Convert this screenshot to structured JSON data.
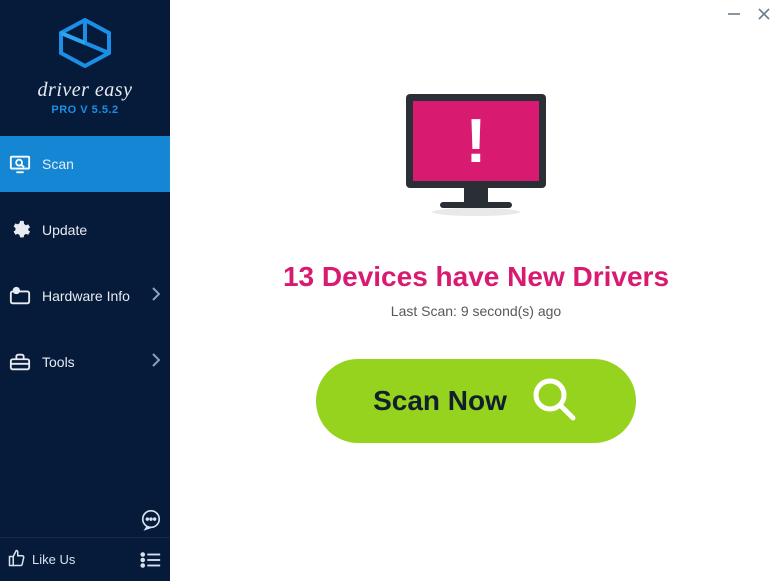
{
  "brand": {
    "title": "driver easy",
    "version": "PRO V 5.5.2"
  },
  "sidebar": {
    "items": [
      {
        "label": "Scan",
        "has_chevron": false,
        "active": true
      },
      {
        "label": "Update",
        "has_chevron": false,
        "active": false
      },
      {
        "label": "Hardware Info",
        "has_chevron": true,
        "active": false
      },
      {
        "label": "Tools",
        "has_chevron": true,
        "active": false
      }
    ],
    "like_label": "Like Us"
  },
  "main": {
    "headline": "13 Devices have New Drivers",
    "last_scan": "Last Scan: 9 second(s) ago",
    "scan_button": "Scan Now"
  },
  "colors": {
    "accent_pink": "#d81b71",
    "accent_green": "#95d31e",
    "sidebar_bg": "#061a3a",
    "active_bg": "#1486d3"
  }
}
